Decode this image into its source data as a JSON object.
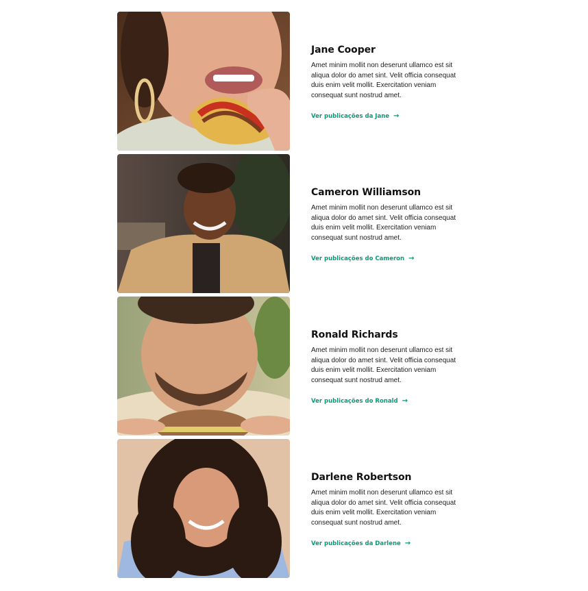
{
  "people": [
    {
      "name": "Jane Cooper",
      "bio": "Amet minim mollit non deserunt ullamco est sit aliqua dolor do amet sint. Velit officia consequat duis enim velit mollit. Exercitation veniam consequat sunt nostrud amet.",
      "link_label": "Ver publicações da Jane",
      "photo_subject": "woman-eating-taco"
    },
    {
      "name": "Cameron Williamson",
      "bio": "Amet minim mollit non deserunt ullamco est sit aliqua dolor do amet sint. Velit officia consequat duis enim velit mollit. Exercitation veniam consequat sunt nostrud amet.",
      "link_label": "Ver publicações do Cameron",
      "photo_subject": "man-smiling-at-table"
    },
    {
      "name": "Ronald Richards",
      "bio": "Amet minim mollit non deserunt ullamco est sit aliqua dolor do amet sint. Velit officia consequat duis enim velit mollit. Exercitation veniam consequat sunt nostrud amet.",
      "link_label": "Ver publicações do Ronald",
      "photo_subject": "man-eating-burger"
    },
    {
      "name": "Darlene Robertson",
      "bio": "Amet minim mollit non deserunt ullamco est sit aliqua dolor do amet sint. Velit officia consequat duis enim velit mollit. Exercitation veniam consequat sunt nostrud amet.",
      "link_label": "Ver publicações da Darlene",
      "photo_subject": "woman-curly-hair-smiling"
    }
  ],
  "icons": {
    "arrow": "arrow-right-icon"
  },
  "colors": {
    "link": "#0a9a7a",
    "text": "#111111",
    "background": "#ffffff"
  }
}
